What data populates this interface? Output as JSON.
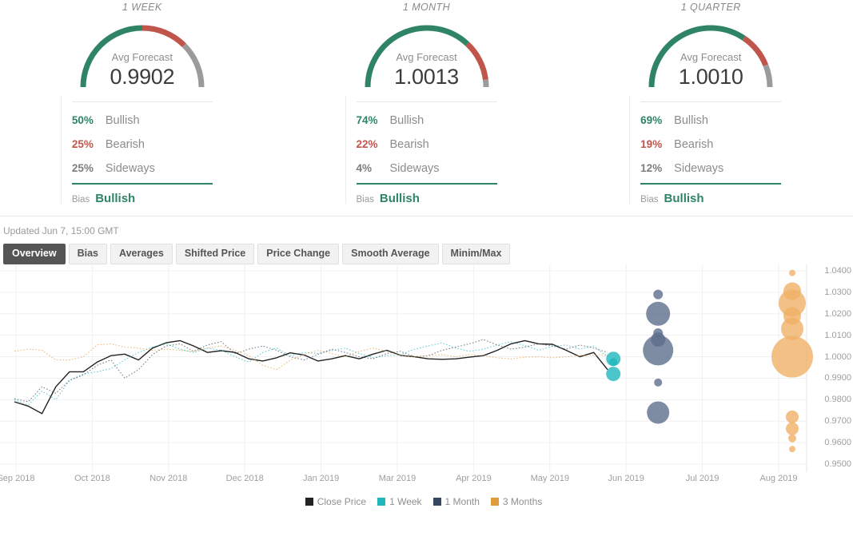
{
  "gauges": [
    {
      "title": "1 WEEK",
      "forecast_label": "Avg Forecast",
      "forecast_value": "0.9902",
      "stats": [
        {
          "pct": "50%",
          "name": "Bullish",
          "kind": "bull"
        },
        {
          "pct": "25%",
          "name": "Bearish",
          "kind": "bear"
        },
        {
          "pct": "25%",
          "name": "Sideways",
          "kind": "side"
        }
      ],
      "bias_label": "Bias",
      "bias_value": "Bullish",
      "arc": {
        "bull": 50,
        "bear": 25,
        "side": 25
      }
    },
    {
      "title": "1 MONTH",
      "forecast_label": "Avg Forecast",
      "forecast_value": "1.0013",
      "stats": [
        {
          "pct": "74%",
          "name": "Bullish",
          "kind": "bull"
        },
        {
          "pct": "22%",
          "name": "Bearish",
          "kind": "bear"
        },
        {
          "pct": "4%",
          "name": "Sideways",
          "kind": "side"
        }
      ],
      "bias_label": "Bias",
      "bias_value": "Bullish",
      "arc": {
        "bull": 74,
        "bear": 22,
        "side": 4
      }
    },
    {
      "title": "1 QUARTER",
      "forecast_label": "Avg Forecast",
      "forecast_value": "1.0010",
      "stats": [
        {
          "pct": "69%",
          "name": "Bullish",
          "kind": "bull"
        },
        {
          "pct": "19%",
          "name": "Bearish",
          "kind": "bear"
        },
        {
          "pct": "12%",
          "name": "Sideways",
          "kind": "side"
        }
      ],
      "bias_label": "Bias",
      "bias_value": "Bullish",
      "arc": {
        "bull": 69,
        "bear": 19,
        "side": 12
      }
    }
  ],
  "updated": "Updated Jun 7, 15:00 GMT",
  "tabs": [
    {
      "label": "Overview",
      "active": true
    },
    {
      "label": "Bias",
      "active": false
    },
    {
      "label": "Averages",
      "active": false
    },
    {
      "label": "Shifted Price",
      "active": false
    },
    {
      "label": "Price Change",
      "active": false
    },
    {
      "label": "Smooth Average",
      "active": false
    },
    {
      "label": "Minim/Max",
      "active": false
    }
  ],
  "colors": {
    "bullish": "#2f8466",
    "bearish": "#c0564b",
    "neutral": "#9b9b9b",
    "close_price": "#222222",
    "one_week": "#1fb6be",
    "one_month": "#34495e",
    "three_months": "#e09b3d",
    "tab_active_bg": "#555555",
    "grid": "#f0f0f2"
  },
  "chart_data": {
    "type": "line",
    "title": "",
    "xlabel": "",
    "ylabel": "",
    "ylim": [
      0.95,
      1.04
    ],
    "grid": true,
    "legend_position": "bottom",
    "ytick_labels": [
      "1.0400",
      "1.0300",
      "1.0200",
      "1.0100",
      "1.0000",
      "0.9900",
      "0.9800",
      "0.9700",
      "0.9600",
      "0.9500"
    ],
    "ytick_values": [
      1.04,
      1.03,
      1.02,
      1.01,
      1.0,
      0.99,
      0.98,
      0.97,
      0.96,
      0.95
    ],
    "xtick_labels": [
      "Sep 2018",
      "Oct 2018",
      "Nov 2018",
      "Dec 2018",
      "Jan 2019",
      "Mar 2019",
      "Apr 2019",
      "May 2019",
      "Jun 2019",
      "Jul 2019",
      "Aug 2019"
    ],
    "legend": [
      {
        "name": "Close Price",
        "color": "#222222"
      },
      {
        "name": "1 Week",
        "color": "#1fb6be"
      },
      {
        "name": "1 Month",
        "color": "#34495e"
      },
      {
        "name": "3 Months",
        "color": "#e09b3d"
      }
    ],
    "series": [
      {
        "name": "Close Price",
        "color": "#222222",
        "style": "solid",
        "values": [
          0.979,
          0.977,
          0.9735,
          0.986,
          0.993,
          0.993,
          0.9975,
          1.0005,
          1.0012,
          0.9985,
          1.004,
          1.0065,
          1.0075,
          1.005,
          1.002,
          1.0028,
          1.002,
          0.999,
          0.998,
          0.9995,
          1.0018,
          1.0008,
          0.998,
          0.999,
          1.0005,
          0.999,
          1.0012,
          1.003,
          1.0006,
          1.0,
          0.999,
          0.9988,
          0.999,
          0.9998,
          1.0005,
          1.003,
          1.006,
          1.0075,
          1.006,
          1.0058,
          1.003,
          1.0,
          1.002,
          0.994
        ]
      },
      {
        "name": "1 Week",
        "color": "#1fb6be",
        "style": "dotted",
        "values": [
          0.98,
          0.9775,
          0.984,
          0.98,
          0.989,
          0.992,
          0.993,
          0.9945,
          0.9985,
          1.002,
          1.0045,
          1.006,
          1.0035,
          1.002,
          1.004,
          1.003,
          1.0,
          0.9975,
          1.002,
          1.004,
          1.0005,
          1.002,
          1.0015,
          1.003,
          1.004,
          1.0015,
          0.9995,
          1.0005,
          1.001,
          1.0035,
          1.005,
          1.0065,
          1.004,
          1.0025,
          1.0035,
          1.0055,
          1.007,
          1.0052,
          1.003,
          1.0048,
          1.0055,
          1.0035,
          1.005,
          1.0
        ]
      },
      {
        "name": "1 Month",
        "color": "#34495e",
        "style": "dotted",
        "values": [
          0.9805,
          0.979,
          0.986,
          0.983,
          0.989,
          0.9915,
          0.996,
          0.9985,
          0.99,
          0.994,
          1.001,
          1.005,
          1.006,
          1.0025,
          1.0055,
          1.007,
          1.0015,
          1.0035,
          1.005,
          1.003,
          1.0,
          0.9985,
          1.001,
          1.0035,
          1.002,
          1.0,
          0.999,
          1.0015,
          1.0025,
          1.0,
          1.0005,
          1.003,
          1.0045,
          1.006,
          1.008,
          1.0055,
          1.0035,
          1.0045,
          1.006,
          1.005,
          1.0035,
          1.0055,
          1.004,
          1.002
        ]
      },
      {
        "name": "3 Months",
        "color": "#e09b3d",
        "style": "dotted",
        "values": [
          1.0025,
          1.0035,
          1.003,
          0.9985,
          0.9985,
          1.0,
          1.0055,
          1.006,
          1.0045,
          1.004,
          1.003,
          1.0035,
          1.003,
          1.0025,
          1.004,
          1.005,
          1.003,
          1.0005,
          0.996,
          0.994,
          0.9985,
          1.001,
          1.003,
          1.0015,
          1.0,
          1.0025,
          1.004,
          1.0025,
          1.0005,
          1.0,
          1.0005,
          1.001,
          1.0,
          1.001,
          1.0005,
          0.9995,
          0.999,
          0.9998,
          1.0,
          0.9995,
          1.0,
          1.0005,
          1.0008,
          1.001
        ]
      }
    ],
    "bubbles": [
      {
        "series": "1 Week",
        "color": "#1fb6be",
        "x_label": "Jun 2019",
        "points": [
          {
            "value": 0.999,
            "size": 9
          },
          {
            "value": 0.9975,
            "size": 5
          },
          {
            "value": 0.992,
            "size": 9
          }
        ]
      },
      {
        "series": "1 Month",
        "color": "#5c6e8c",
        "x_label": "Jun 2019",
        "points": [
          {
            "value": 1.029,
            "size": 6
          },
          {
            "value": 1.02,
            "size": 15
          },
          {
            "value": 1.011,
            "size": 6
          },
          {
            "value": 1.008,
            "size": 9
          },
          {
            "value": 1.003,
            "size": 19
          },
          {
            "value": 0.988,
            "size": 5
          },
          {
            "value": 0.974,
            "size": 14
          }
        ]
      },
      {
        "series": "3 Months",
        "color": "#f0b067",
        "x_label": "Aug 2019",
        "points": [
          {
            "value": 1.039,
            "size": 4
          },
          {
            "value": 1.0305,
            "size": 11
          },
          {
            "value": 1.025,
            "size": 17
          },
          {
            "value": 1.019,
            "size": 11
          },
          {
            "value": 1.013,
            "size": 14
          },
          {
            "value": 1.0,
            "size": 26
          },
          {
            "value": 0.972,
            "size": 8
          },
          {
            "value": 0.9665,
            "size": 8
          },
          {
            "value": 0.962,
            "size": 5
          },
          {
            "value": 0.957,
            "size": 4
          }
        ]
      }
    ]
  }
}
